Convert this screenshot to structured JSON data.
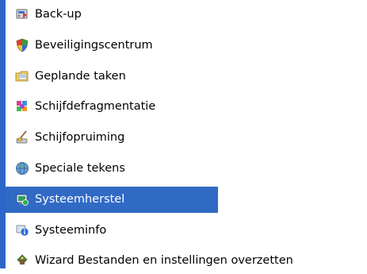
{
  "menu": {
    "items": [
      {
        "label": "Back-up",
        "icon": "backup-icon"
      },
      {
        "label": "Beveiligingscentrum",
        "icon": "security-center-shield-icon"
      },
      {
        "label": "Geplande taken",
        "icon": "scheduled-tasks-folder-icon"
      },
      {
        "label": "Schijfdefragmentatie",
        "icon": "disk-defragmenter-icon"
      },
      {
        "label": "Schijfopruiming",
        "icon": "disk-cleanup-icon"
      },
      {
        "label": "Speciale tekens",
        "icon": "character-map-icon"
      },
      {
        "label": "Systeemherstel",
        "icon": "system-restore-icon",
        "selected": true
      },
      {
        "label": "Systeeminfo",
        "icon": "system-information-icon"
      },
      {
        "label": "Wizard Bestanden en instellingen overzetten",
        "icon": "transfer-wizard-icon"
      }
    ],
    "selected_color": "#316ac5",
    "bar_color": "#2e66c8"
  }
}
